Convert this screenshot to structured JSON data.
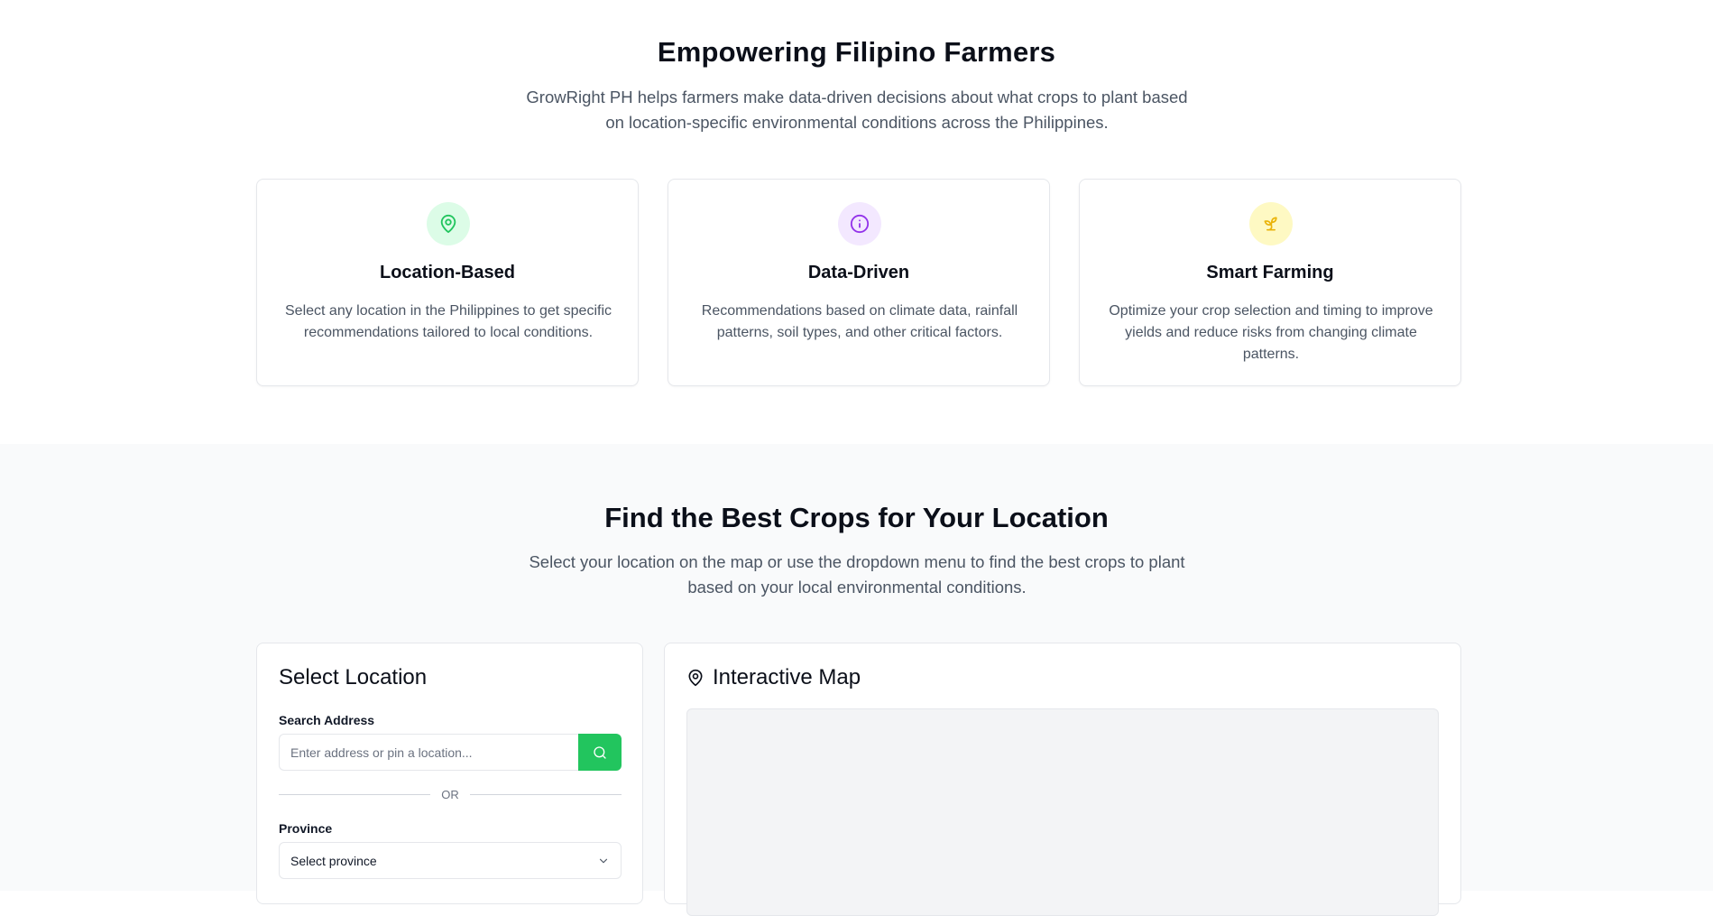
{
  "hero": {
    "title": "Empowering Filipino Farmers",
    "subtitle": "GrowRight PH helps farmers make data-driven decisions about what crops to plant based on location-specific environmental conditions across the Philippines."
  },
  "features": [
    {
      "icon": "map-pin-icon",
      "title": "Location-Based",
      "description": "Select any location in the Philippines to get specific recommendations tailored to local conditions."
    },
    {
      "icon": "info-icon",
      "title": "Data-Driven",
      "description": "Recommendations based on climate data, rainfall patterns, soil types, and other critical factors."
    },
    {
      "icon": "sprout-icon",
      "title": "Smart Farming",
      "description": "Optimize your crop selection and timing to improve yields and reduce risks from changing climate patterns."
    }
  ],
  "finder": {
    "title": "Find the Best Crops for Your Location",
    "subtitle": "Select your location on the map or use the dropdown menu to find the best crops to plant based on your local environmental conditions."
  },
  "select_panel": {
    "title": "Select Location",
    "search_label": "Search Address",
    "search_placeholder": "Enter address or pin a location...",
    "search_value": "",
    "or_text": "OR",
    "province_label": "Province",
    "province_value": "Select province"
  },
  "map_panel": {
    "title": "Interactive Map"
  },
  "colors": {
    "accent_green": "#22c55e",
    "green_tint": "#dcfce7",
    "purple_tint": "#f3e8ff",
    "yellow_tint": "#fef9c3",
    "purple": "#9333ea",
    "yellow": "#eab308",
    "section_bg": "#f9fafb",
    "map_bg": "#f3f4f6"
  }
}
